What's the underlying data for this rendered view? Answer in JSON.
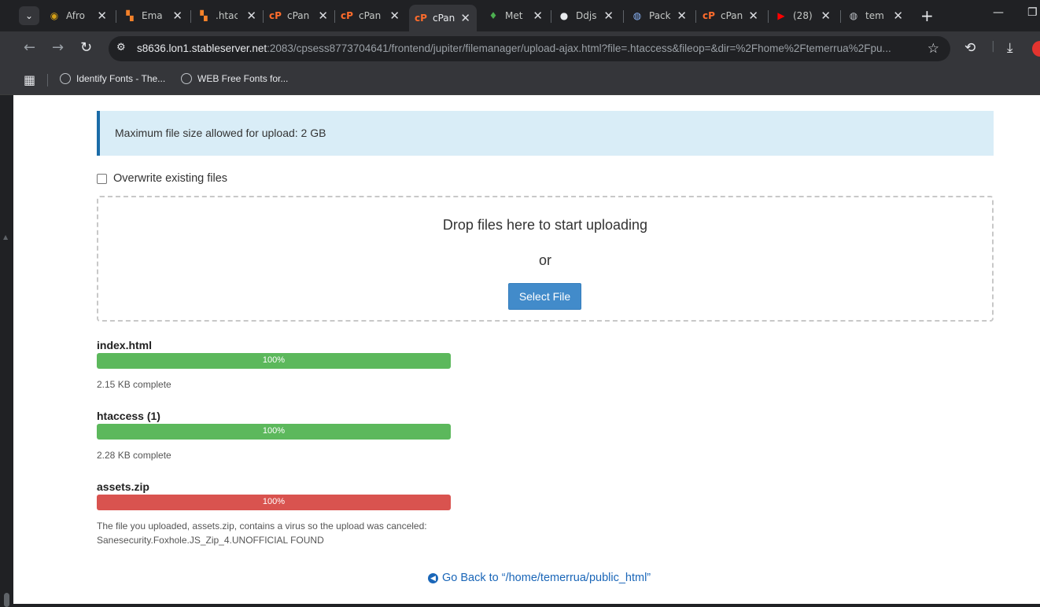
{
  "browser": {
    "tabs": [
      {
        "title": "Afro",
        "favicon": "afro-icon",
        "active": false
      },
      {
        "title": "Ema",
        "favicon": "bars-icon",
        "active": false
      },
      {
        "title": ".htac",
        "favicon": "bars-icon",
        "active": false
      },
      {
        "title": "cPan",
        "favicon": "cpanel-icon",
        "active": false
      },
      {
        "title": "cPan",
        "favicon": "cpanel-icon",
        "active": false
      },
      {
        "title": "cPan",
        "favicon": "cpanel-icon",
        "active": true
      },
      {
        "title": "Met",
        "favicon": "leaf-icon",
        "active": false
      },
      {
        "title": "Ddjs",
        "favicon": "github-icon",
        "active": false
      },
      {
        "title": "Pack",
        "favicon": "globe-icon",
        "active": false
      },
      {
        "title": "cPan",
        "favicon": "cpanel-icon",
        "active": false
      },
      {
        "title": "(28)",
        "favicon": "youtube-icon",
        "active": false
      },
      {
        "title": "tem",
        "favicon": "globe-icon",
        "active": false
      }
    ],
    "url_host": "s8636.lon1.stableserver.net",
    "url_rest": ":2083/cpsess8773704641/frontend/jupiter/filemanager/upload-ajax.html?file=.htaccess&fileop=&dir=%2Fhome%2Ftemerrua%2Fpu...",
    "bookmarks": [
      {
        "label": "Identify Fonts - The..."
      },
      {
        "label": "WEB Free Fonts for..."
      }
    ]
  },
  "upload": {
    "max_size_text": "Maximum file size allowed for upload: 2 GB",
    "overwrite_label": "Overwrite existing files",
    "drop_text": "Drop files here to start uploading",
    "or_text": "or",
    "select_file_label": "Select File",
    "files": [
      {
        "name": "index.html",
        "progress_label": "100%",
        "progress": 100,
        "state": "success",
        "status": "2.15 KB complete"
      },
      {
        "name": "htaccess (1)",
        "progress_label": "100%",
        "progress": 100,
        "state": "success",
        "status": "2.28 KB complete"
      },
      {
        "name": "assets.zip",
        "progress_label": "100%",
        "progress": 100,
        "state": "error",
        "status": "The file you uploaded, assets.zip, contains a virus so the upload was canceled: Sanesecurity.Foxhole.JS_Zip_4.UNOFFICIAL FOUND"
      }
    ],
    "go_back_label": "Go Back to “/home/temerrua/public_html”"
  },
  "colors": {
    "success": "#5cb85c",
    "error": "#d9534f",
    "link": "#1a66b8",
    "alert_bg": "#d9edf7"
  }
}
